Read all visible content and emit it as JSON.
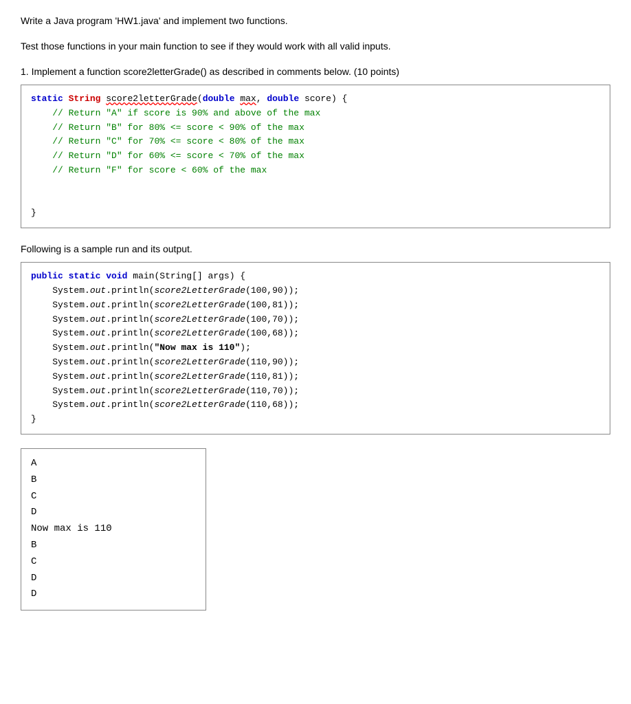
{
  "intro": {
    "line1": "Write a Java program 'HW1.java' and implement two functions.",
    "line2": "Test those functions in your main function to see if they would work with all valid inputs."
  },
  "section1": {
    "title": "1. Implement a function score2letterGrade() as described in comments below. (10 points)"
  },
  "section2": {
    "title": "Following is a sample run and its output."
  },
  "output": {
    "lines": [
      "A",
      "B",
      "C",
      "D",
      "Now max is 110",
      "B",
      "C",
      "D",
      "D"
    ]
  }
}
